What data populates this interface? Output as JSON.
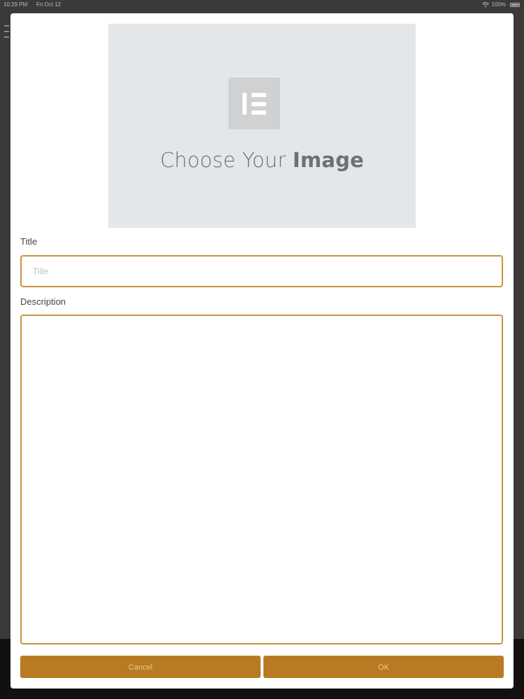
{
  "status_bar": {
    "time": "10:29 PM",
    "date": "Fri Oct 12",
    "battery": "100%"
  },
  "image_picker": {
    "prefix": "Choose Your ",
    "emphasis": "Image",
    "logo_icon": "elementor-logo-icon"
  },
  "form": {
    "title_label": "Title",
    "title_placeholder": "Title",
    "title_value": "",
    "description_label": "Description",
    "description_value": ""
  },
  "actions": {
    "cancel_label": "Cancel",
    "ok_label": "OK"
  },
  "colors": {
    "accent": "#c8943e",
    "button": "#b87b23",
    "button_text": "#e8c98f",
    "picker_bg": "#e4e7e9"
  }
}
